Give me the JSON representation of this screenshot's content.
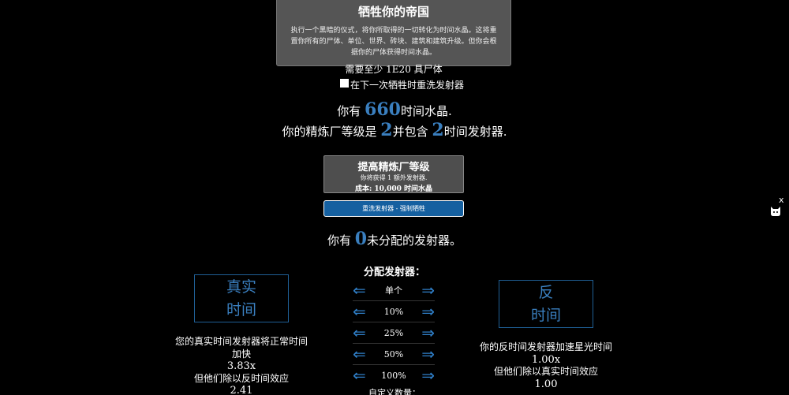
{
  "sacrifice": {
    "title": "牺牲你的帝国",
    "description": "执行一个黑暗的仪式，将你所取得的一切转化为时间水晶。这将重置你所有的尸体、单位、世界、砖块、建筑和建筑升级。但你会根据你的尸体获得时间水晶。",
    "requirement": "需要至少 1E20 具尸体"
  },
  "respec_checkbox": {
    "label": "在下一次牺牲时重洗发射器",
    "checked": false
  },
  "crystals": {
    "prefix": "你有",
    "value": "660",
    "suffix": "时间水晶."
  },
  "refinery": {
    "prefix": "你的精炼厂等级是",
    "level": "2",
    "middle": "并包含",
    "emitters": "2",
    "suffix": "时间发射器."
  },
  "upgrade": {
    "title": "提高精炼厂等级",
    "gain": "你将获得 1 额外发射器.",
    "cost": "成本: 10,000 时间水晶"
  },
  "respec_button": {
    "label": "重洗发射器 - 强制牺牲"
  },
  "close_label": "x",
  "unassigned": {
    "prefix": "你有",
    "value": "0",
    "suffix": "未分配的发射器。"
  },
  "real_time": {
    "line1": "真实",
    "line2": "时间",
    "desc1": "您的真实时间发射器将正常时间",
    "desc2": "加快",
    "multiplier": "3.83x",
    "desc3": "但他们除以反时间效应",
    "divisor": "2.41"
  },
  "anti_time": {
    "line1": "反",
    "line2": "时间",
    "desc1": "你的反时间发射器加速星光时间",
    "multiplier": "1.00x",
    "desc2": "但他们除以真实时间效应",
    "divisor": "1.00"
  },
  "allocate": {
    "title": "分配发射器：",
    "options": [
      "单个",
      "10%",
      "25%",
      "50%",
      "100%"
    ],
    "left_arrow": "⇐",
    "right_arrow": "⇒",
    "custom_label": "自定义数量："
  },
  "colors": {
    "accent": "#3a7fbf",
    "button_gray": "#555555",
    "respec_blue": "#1560a0"
  }
}
